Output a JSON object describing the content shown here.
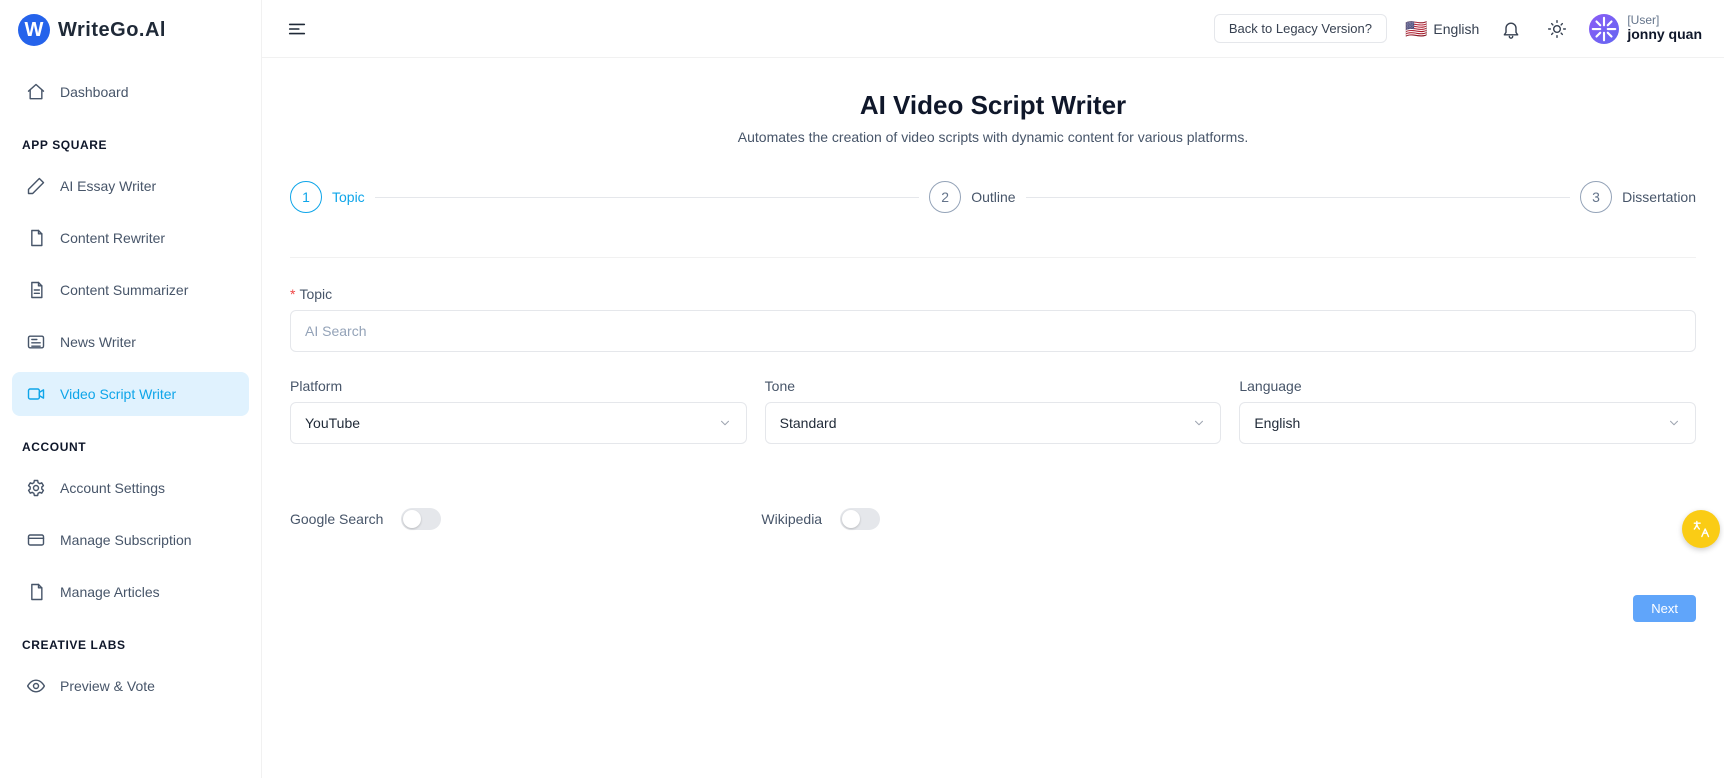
{
  "logo": {
    "text": "WriteGo.Al"
  },
  "sidebar": {
    "dashboard": "Dashboard",
    "groups": {
      "app_square": "APP SQUARE",
      "account": "ACCOUNT",
      "creative_labs": "CREATIVE LABS"
    },
    "items": {
      "ai_essay_writer": "AI Essay Writer",
      "content_rewriter": "Content Rewriter",
      "content_summarizer": "Content Summarizer",
      "news_writer": "News Writer",
      "video_script_writer": "Video Script Writer",
      "account_settings": "Account Settings",
      "manage_subscription": "Manage Subscription",
      "manage_articles": "Manage Articles",
      "preview_vote": "Preview & Vote"
    }
  },
  "header": {
    "legacy": "Back to Legacy Version?",
    "language": "English",
    "flag": "🇺🇸",
    "user_label": "[User]",
    "user_name": "jonny quan"
  },
  "page": {
    "title": "AI Video Script Writer",
    "subtitle": "Automates the creation of video scripts with dynamic content for various platforms."
  },
  "steps": {
    "s1": {
      "num": "1",
      "label": "Topic"
    },
    "s2": {
      "num": "2",
      "label": "Outline"
    },
    "s3": {
      "num": "3",
      "label": "Dissertation"
    }
  },
  "form": {
    "topic_label": "Topic",
    "topic_placeholder": "AI Search",
    "platform_label": "Platform",
    "platform_value": "YouTube",
    "tone_label": "Tone",
    "tone_value": "Standard",
    "language_label": "Language",
    "language_value": "English",
    "google_search_label": "Google Search",
    "wikipedia_label": "Wikipedia",
    "next": "Next"
  }
}
